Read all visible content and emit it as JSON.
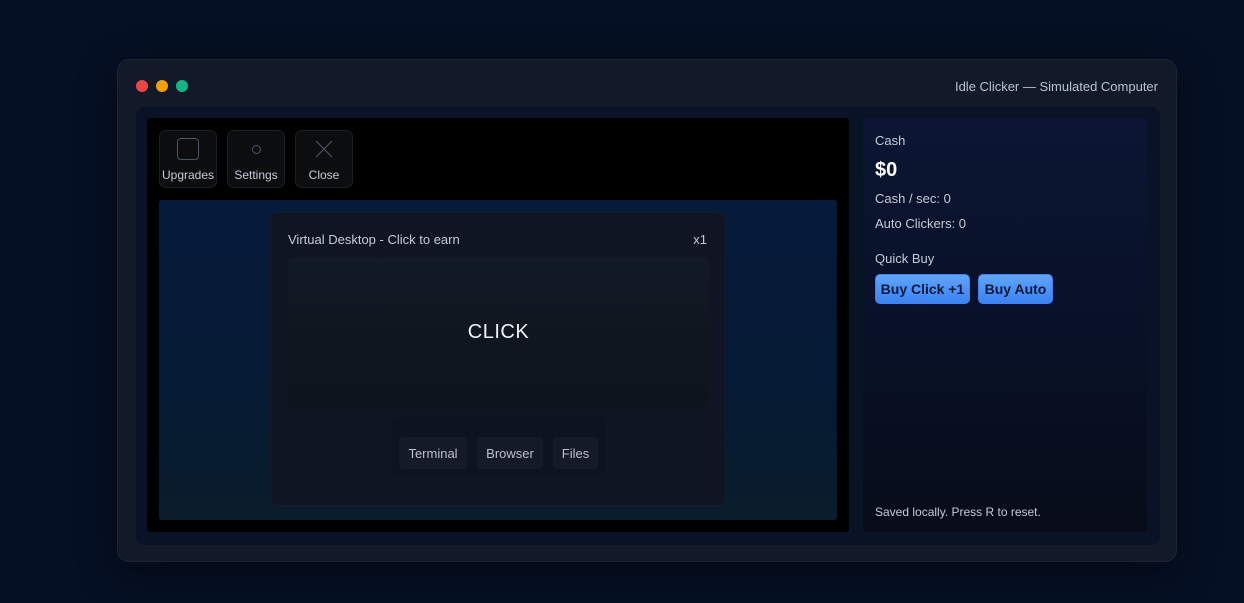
{
  "window": {
    "title": "Idle Clicker — Simulated Computer"
  },
  "taskbar": {
    "upgrades_label": "Upgrades",
    "settings_label": "Settings",
    "close_label": "Close"
  },
  "virtual_window": {
    "title": "Virtual Desktop - Click to earn",
    "multiplier": "x1",
    "click_label": "CLICK"
  },
  "dock": {
    "items": [
      {
        "label": "Terminal"
      },
      {
        "label": "Browser"
      },
      {
        "label": "Files"
      }
    ]
  },
  "panel": {
    "cash_label": "Cash",
    "cash_value": "$0",
    "cash_per_sec": "Cash / sec: 0",
    "auto_clickers": "Auto Clickers: 0",
    "quick_buy_label": "Quick Buy",
    "buy_click_label": "Buy Click +1",
    "buy_auto_label": "Buy Auto",
    "saved_note": "Saved locally. Press R to reset."
  },
  "colors": {
    "page_bg": "#061024",
    "accent": "#3b82f6",
    "traffic_red": "#ef4444",
    "traffic_yellow": "#f59e0b",
    "traffic_green": "#10b981"
  }
}
